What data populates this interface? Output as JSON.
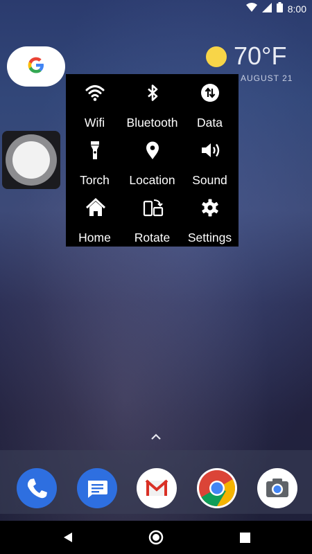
{
  "status": {
    "time": "8:00"
  },
  "search": {
    "logo": "G"
  },
  "weather": {
    "temperature": "70°F",
    "date": "AUGUST 21"
  },
  "quick_panel": {
    "tiles": [
      {
        "label": "Wifi",
        "icon": "wifi-icon"
      },
      {
        "label": "Bluetooth",
        "icon": "bluetooth-icon"
      },
      {
        "label": "Data",
        "icon": "data-icon"
      },
      {
        "label": "Torch",
        "icon": "torch-icon"
      },
      {
        "label": "Location",
        "icon": "location-icon"
      },
      {
        "label": "Sound",
        "icon": "sound-icon"
      },
      {
        "label": "Home",
        "icon": "home-icon"
      },
      {
        "label": "Rotate",
        "icon": "rotate-icon"
      },
      {
        "label": "Settings",
        "icon": "settings-icon"
      }
    ]
  },
  "dock": {
    "apps": [
      {
        "name": "phone-app",
        "color": "#2e6fe0"
      },
      {
        "name": "messages-app",
        "color": "#2e6fe0"
      },
      {
        "name": "gmail-app",
        "color": "#ffffff"
      },
      {
        "name": "chrome-app",
        "color": "#ffffff"
      },
      {
        "name": "camera-app",
        "color": "#ffffff"
      }
    ]
  }
}
